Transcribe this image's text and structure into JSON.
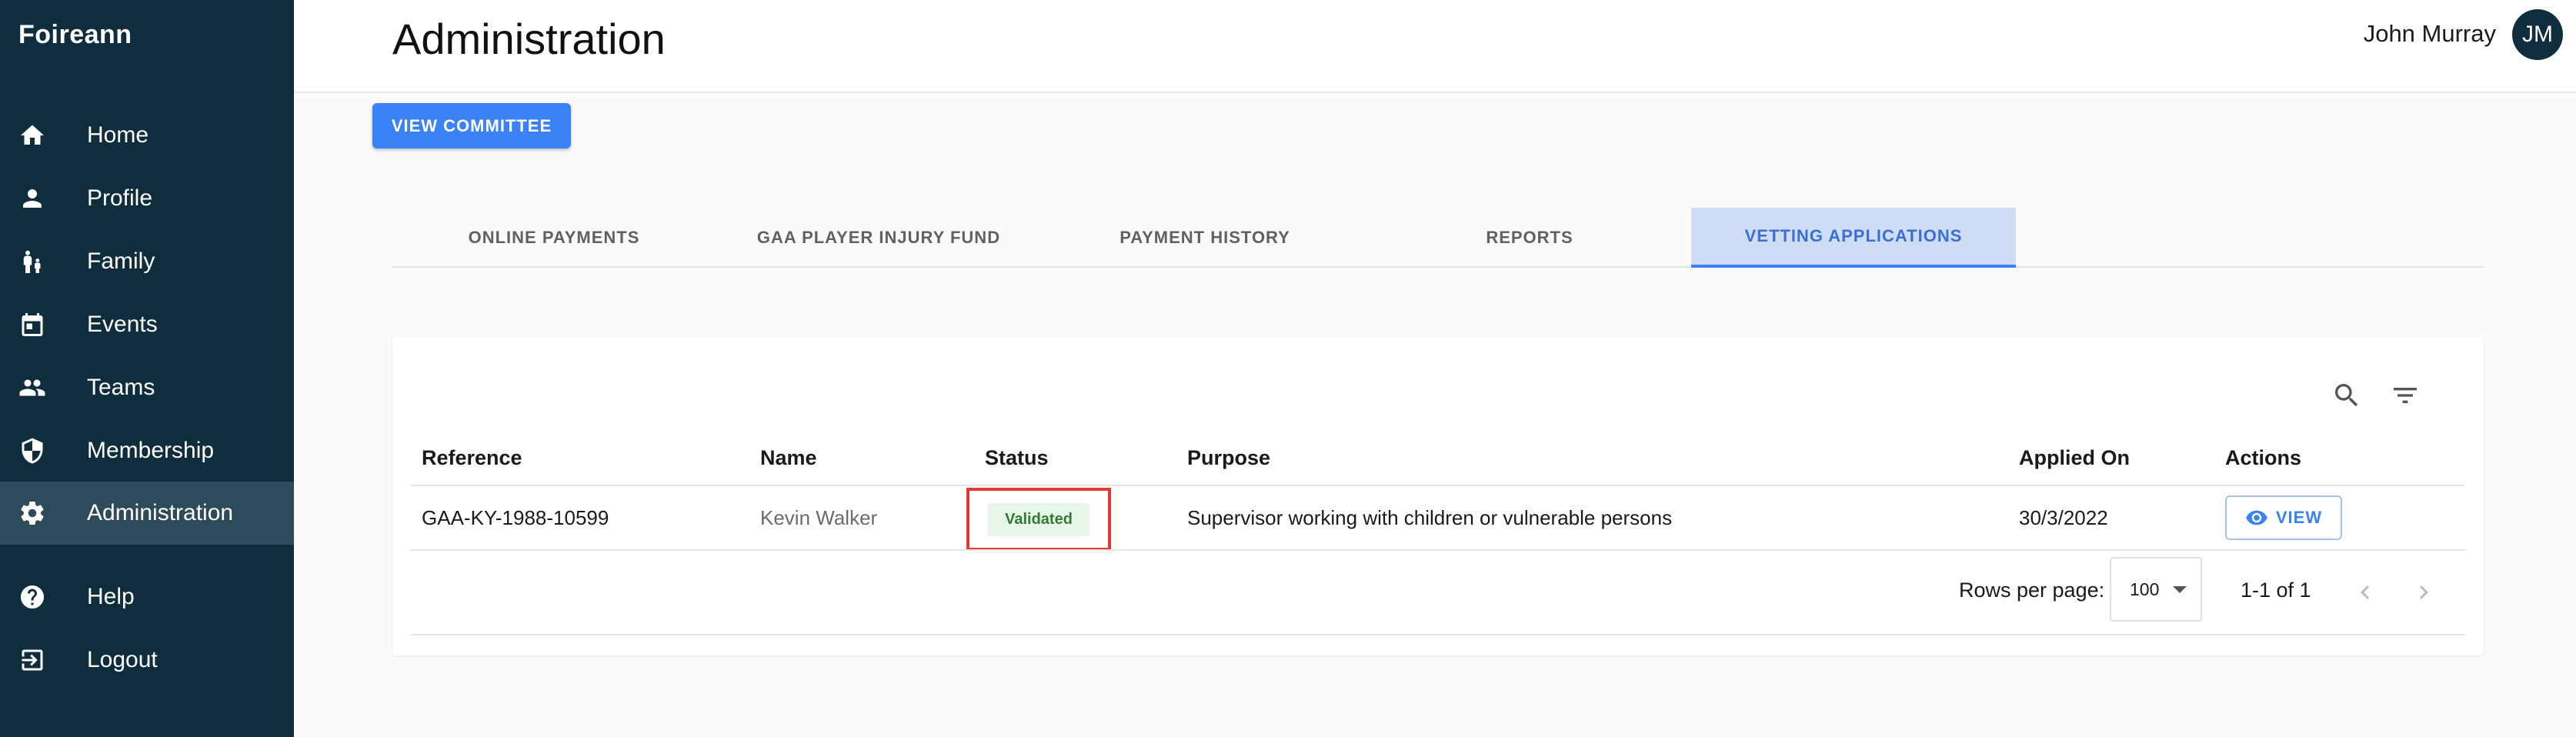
{
  "app": {
    "brand": "Foireann"
  },
  "sidebar": {
    "items": [
      {
        "label": "Home",
        "icon": "home-icon"
      },
      {
        "label": "Profile",
        "icon": "person-icon"
      },
      {
        "label": "Family",
        "icon": "family-icon"
      },
      {
        "label": "Events",
        "icon": "calendar-icon"
      },
      {
        "label": "Teams",
        "icon": "people-icon"
      },
      {
        "label": "Membership",
        "icon": "shield-icon"
      },
      {
        "label": "Administration",
        "icon": "gear-icon",
        "active": true
      },
      {
        "label": "Help",
        "icon": "help-icon"
      },
      {
        "label": "Logout",
        "icon": "logout-icon"
      }
    ]
  },
  "header": {
    "title": "Administration",
    "user_name": "John Murray",
    "avatar_initials": "JM"
  },
  "committee_button": "VIEW COMMITTEE",
  "tabs": [
    {
      "label": "ONLINE PAYMENTS"
    },
    {
      "label": "GAA PLAYER INJURY FUND"
    },
    {
      "label": "PAYMENT HISTORY"
    },
    {
      "label": "REPORTS"
    },
    {
      "label": "VETTING APPLICATIONS",
      "active": true
    }
  ],
  "table": {
    "columns": [
      "Reference",
      "Name",
      "Status",
      "Purpose",
      "Applied On",
      "Actions"
    ],
    "rows": [
      {
        "reference": "GAA-KY-1988-10599",
        "name": "Kevin Walker",
        "status": "Validated",
        "purpose": "Supervisor working with children or vulnerable persons",
        "applied_on": "30/3/2022",
        "action": "VIEW"
      }
    ],
    "pagination": {
      "rows_per_page_label": "Rows per page:",
      "rows_per_page": "100",
      "range": "1-1 of 1"
    }
  },
  "colors": {
    "sidebar_bg": "#0f2d3d",
    "sidebar_active": "#2e4b5b",
    "primary": "#3b82f6",
    "status_validated": "#2e7d32",
    "highlight_box": "#e53935"
  }
}
